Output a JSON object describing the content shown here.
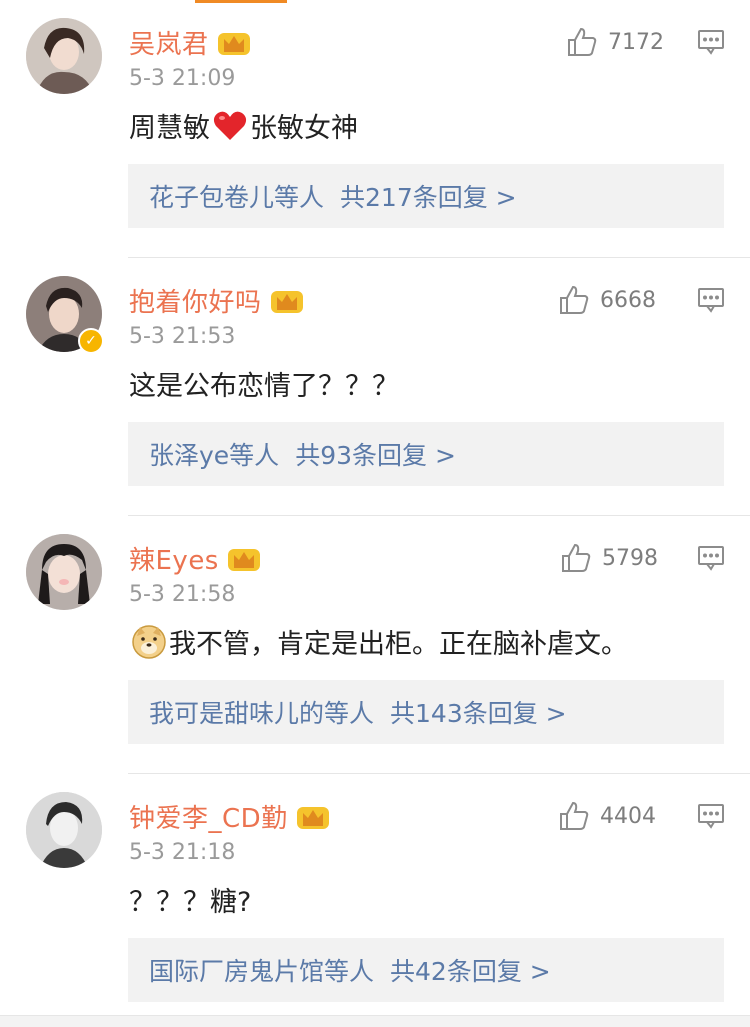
{
  "colors": {
    "username": "#eb7350",
    "link": "#5b7aa8",
    "time": "#9a9a9a",
    "reply_box_bg": "#f2f2f2",
    "accent": "#f08a24"
  },
  "comments": [
    {
      "username": "吴岚君",
      "time": "5-3 21:09",
      "likes": "7172",
      "content_before": "周慧敏",
      "emoji": "red-heart-icon",
      "content_after": "张敏女神",
      "replies_users": "花子包卷儿等人",
      "replies_count_text": "共217条回复 >",
      "verified": false
    },
    {
      "username": "抱着你好吗",
      "time": "5-3 21:53",
      "likes": "6668",
      "content": "这是公布恋情了？？？",
      "replies_users": "张泽ye等人",
      "replies_count_text": "共93条回复 >",
      "verified": true
    },
    {
      "username": "辣Eyes",
      "time": "5-3 21:58",
      "likes": "5798",
      "emoji": "doge-icon",
      "content_after": "我不管，肯定是出柜。正在脑补虐文。",
      "replies_users": "我可是甜味儿的等人",
      "replies_count_text": "共143条回复 >",
      "verified": false
    },
    {
      "username": "钟爱李_CD勤",
      "time": "5-3 21:18",
      "likes": "4404",
      "content": "？？？糖?",
      "replies_users": "国际厂房鬼片馆等人",
      "replies_count_text": "共42条回复 >",
      "verified": false
    }
  ]
}
